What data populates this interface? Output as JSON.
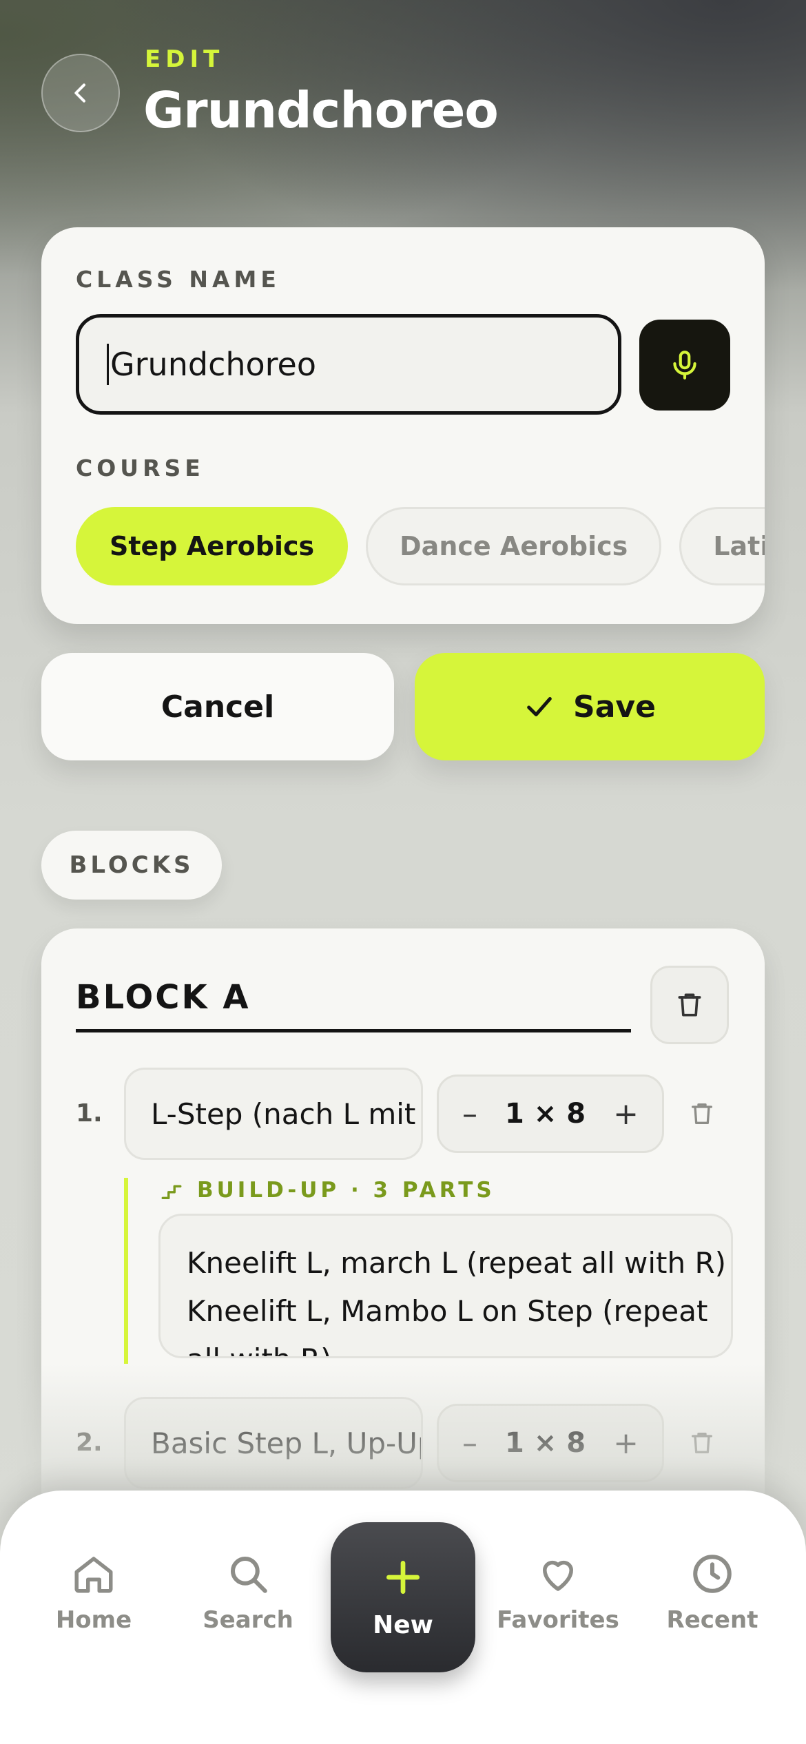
{
  "header": {
    "kicker": "EDIT",
    "title": "Grundchoreo"
  },
  "class_card": {
    "name_label": "CLASS NAME",
    "name_value": "Grundchoreo",
    "course_label": "COURSE",
    "courses": [
      {
        "label": "Step Aerobics",
        "active": true
      },
      {
        "label": "Dance Aerobics",
        "active": false
      },
      {
        "label": "Latin Dance",
        "active": false
      }
    ]
  },
  "actions": {
    "cancel_label": "Cancel",
    "save_label": "Save"
  },
  "blocks": {
    "section_label": "BLOCKS",
    "block": {
      "title": "BLOCK A",
      "steps": [
        {
          "number": "1.",
          "name": "L-Step (nach L mit Step)",
          "count": "1 × 8"
        },
        {
          "number": "2.",
          "name": "Basic Step L, Up-Up",
          "count": "1 × 8"
        }
      ],
      "buildup": {
        "label": "BUILD-UP · 3 PARTS",
        "lines": [
          "Kneelift L, march L (repeat all with R)",
          "Kneelift L, Mambo L on Step (repeat",
          "all with R)"
        ]
      }
    }
  },
  "nav": {
    "home": "Home",
    "search": "Search",
    "new": "New",
    "favorites": "Favorites",
    "recent": "Recent"
  },
  "colors": {
    "accent": "#d6f53a",
    "dark": "#141414"
  }
}
